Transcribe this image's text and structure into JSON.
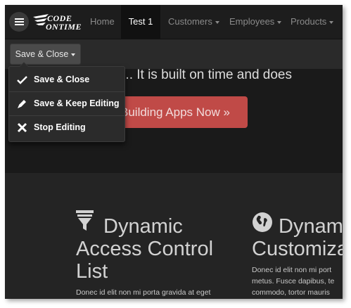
{
  "nav": {
    "logo_line1": "CODE",
    "logo_line2": "ONTIME",
    "home": "Home",
    "active_tab": "Test 1",
    "customers": "Customers",
    "employees": "Employees",
    "products": "Products"
  },
  "toolbar": {
    "save_close_label": "Save & Close"
  },
  "dropdown": {
    "items": [
      {
        "label": "Save & Close",
        "icon": "checkmark-icon"
      },
      {
        "label": "Save & Keep Editing",
        "icon": "pencil-icon"
      },
      {
        "label": "Stop Editing",
        "icon": "x-icon"
      }
    ]
  },
  "hero": {
    "text": "least... It is built on time and does",
    "cta": "Building Apps Now »"
  },
  "features": [
    {
      "title_lines": [
        "Dynamic",
        "Access Control",
        "List"
      ],
      "desc": "Donec id elit non mi porta gravida at eget",
      "icon": "filter-icon"
    },
    {
      "title_lines": [
        "Dynam",
        "Customiza"
      ],
      "desc_lines": [
        "Donec id elit non mi port",
        "metus. Fusce dapibus, te",
        "commodo, tortor mauris"
      ],
      "icon": "globe-icon"
    }
  ],
  "colors": {
    "cta": "#c04a47",
    "background": "#222222"
  }
}
